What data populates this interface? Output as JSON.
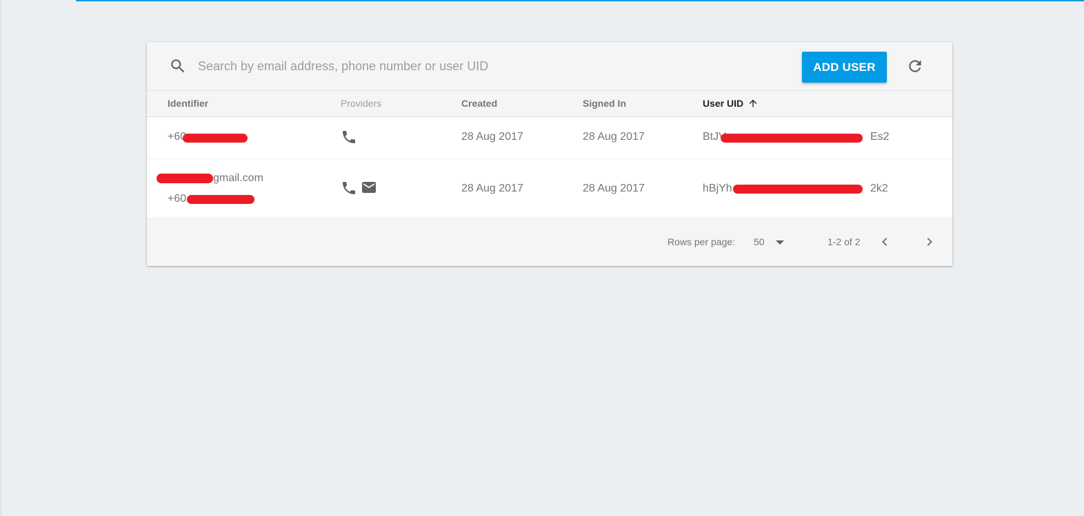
{
  "colors": {
    "accent": "#039be5",
    "redaction": "#ed1c24",
    "background": "#eceff1",
    "toolbar_bg": "#f5f5f5"
  },
  "search": {
    "icon": "search-icon",
    "placeholder": "Search by email address, phone number or user UID",
    "value": ""
  },
  "toolbar": {
    "add_user_label": "ADD USER",
    "refresh_icon": "refresh-icon"
  },
  "table": {
    "columns": [
      {
        "label": "Identifier"
      },
      {
        "label": "Providers"
      },
      {
        "label": "Created"
      },
      {
        "label": "Signed In"
      },
      {
        "label": "User UID",
        "sorted": "ascending",
        "sort_icon": "arrow-up-icon"
      }
    ],
    "rows": [
      {
        "identifier_lines": [
          "+60"
        ],
        "providers": [
          "phone-icon"
        ],
        "created": "28 Aug 2017",
        "signed_in": "28 Aug 2017",
        "uid_prefix": "BtJV",
        "uid_suffix": "Es2"
      },
      {
        "identifier_lines": [
          "gmail.com",
          "+60"
        ],
        "providers": [
          "phone-icon",
          "email-icon"
        ],
        "created": "28 Aug 2017",
        "signed_in": "28 Aug 2017",
        "uid_prefix": "hBjYh",
        "uid_suffix": "2k2"
      }
    ]
  },
  "pagination": {
    "rows_per_page_label": "Rows per page:",
    "rows_per_page_value": "50",
    "range_label": "1-2 of 2",
    "prev_icon": "chevron-left-icon",
    "next_icon": "chevron-right-icon"
  }
}
